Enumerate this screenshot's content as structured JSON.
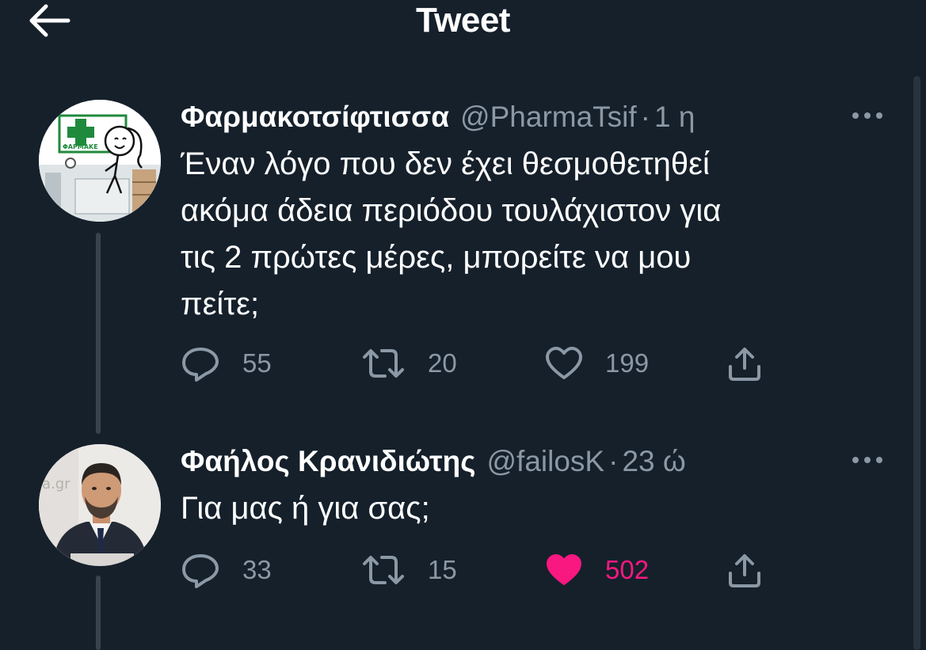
{
  "header": {
    "title": "Tweet",
    "back_icon": "arrow-left-icon"
  },
  "tweets": [
    {
      "display_name": "Φαρμακοτσίφτισσα",
      "handle": "@PharmaTsif",
      "separator": "·",
      "time": "1 η",
      "text": "Έναν λόγο που δεν έχει θεσμοθετηθεί\nακόμα άδεια περιόδου τουλάχιστον για\nτις 2 πρώτες μέρες, μπορείτε να μου\nπείτε;",
      "avatar_sign_text": "ΦΑΡΜΑΚΕ",
      "replies": "55",
      "retweets": "20",
      "likes": "199",
      "liked": false
    },
    {
      "display_name": "Φαήλος Κρανιδιώτης",
      "handle": "@failosK",
      "separator": "·",
      "time": "23 ώ",
      "text": "Για μας ή για σας;",
      "avatar_bg_text": "a.gr",
      "replies": "33",
      "retweets": "15",
      "likes": "502",
      "liked": true
    }
  ],
  "icons": {
    "reply": "reply-bubble-icon",
    "retweet": "retweet-icon",
    "like": "heart-icon",
    "like_filled": "heart-filled-icon",
    "share": "share-icon",
    "more": "more-dots-icon"
  },
  "colors": {
    "background": "#15202b",
    "text": "#ffffff",
    "secondary": "#8b98a5",
    "like_active": "#f91880",
    "thread_line": "#38444d"
  }
}
